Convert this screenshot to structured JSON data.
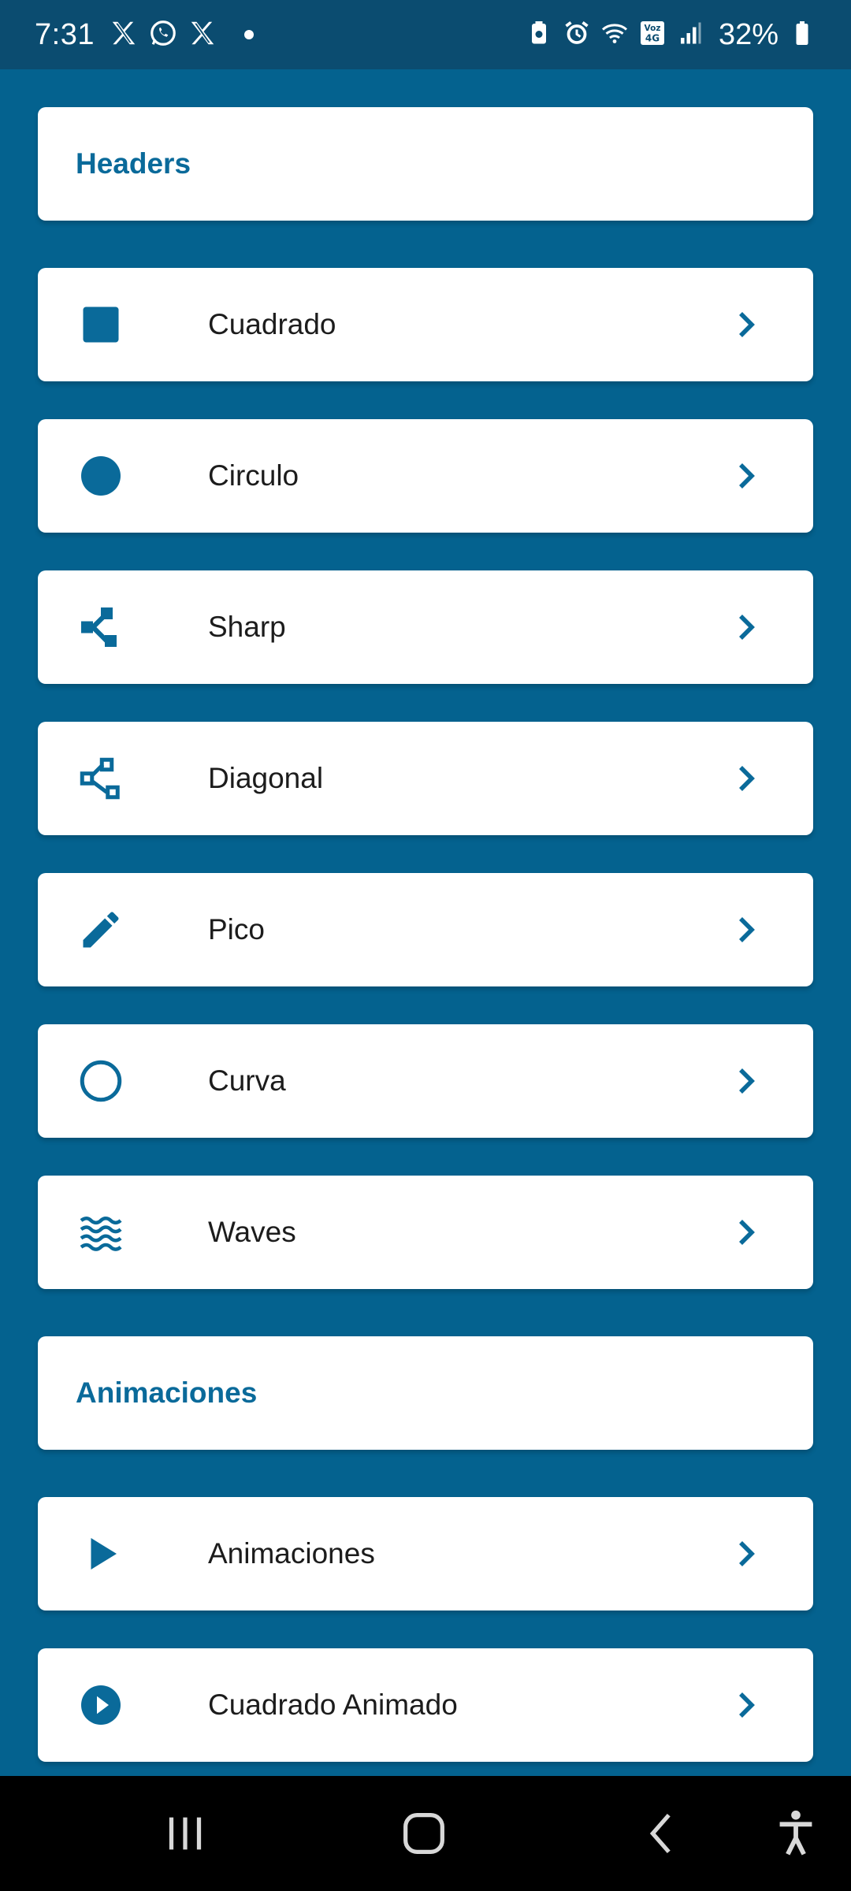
{
  "status_bar": {
    "time": "7:31",
    "battery": "32%",
    "network_label": "Voz 4G",
    "notification_icons": [
      "x-icon",
      "whatsapp-icon",
      "x-icon",
      "dot-icon"
    ],
    "system_icons": [
      "battery-saver-icon",
      "alarm-icon",
      "wifi-icon",
      "volte-4g-icon",
      "signal-icon",
      "battery-icon"
    ]
  },
  "colors": {
    "background": "#04628f",
    "accent": "#0a6a9a",
    "status_bar": "#0b4c70",
    "card": "#ffffff",
    "text": "#1c1c1c"
  },
  "sections": {
    "headers": {
      "title": "Headers",
      "items": [
        {
          "label": "Cuadrado",
          "icon": "square-icon"
        },
        {
          "label": "Circulo",
          "icon": "circle-icon"
        },
        {
          "label": "Sharp",
          "icon": "share-sharp-icon"
        },
        {
          "label": "Diagonal",
          "icon": "diagonal-nodes-icon"
        },
        {
          "label": "Pico",
          "icon": "pencil-icon"
        },
        {
          "label": "Curva",
          "icon": "circle-outline-icon"
        },
        {
          "label": "Waves",
          "icon": "waves-icon"
        }
      ]
    },
    "animations": {
      "title": "Animaciones",
      "items": [
        {
          "label": "Animaciones",
          "icon": "play-arrow-icon"
        },
        {
          "label": "Cuadrado Animado",
          "icon": "play-circle-icon"
        }
      ]
    }
  },
  "nav_bar": {
    "buttons": [
      "recent-apps-icon",
      "home-icon",
      "back-icon",
      "accessibility-icon"
    ]
  }
}
